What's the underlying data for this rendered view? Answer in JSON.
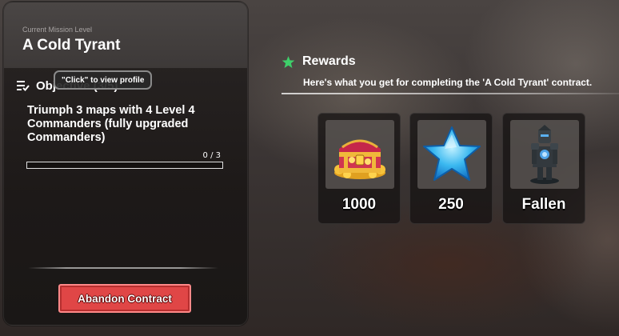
{
  "mission": {
    "subtitle": "Current Mission Level",
    "title": "A Cold Tyrant",
    "objective_label": "Objective (3/5)",
    "tooltip": "\"Click\" to view profile",
    "objective_text": "Triumph 3 maps with 4 Level 4 Commanders (fully upgraded Commanders)",
    "progress_text": "0 / 3",
    "progress_fraction": 0,
    "abandon_label": "Abandon Contract"
  },
  "rewards": {
    "title": "Rewards",
    "description": "Here's what you get for completing the 'A Cold Tyrant' contract.",
    "items": [
      {
        "icon": "treasure-chest-icon",
        "value": "1000"
      },
      {
        "icon": "blue-star-icon",
        "value": "250"
      },
      {
        "icon": "fallen-figure-icon",
        "value": "Fallen"
      }
    ]
  },
  "colors": {
    "accent_green": "#3ecf6a",
    "abandon_red": "#e04646"
  }
}
